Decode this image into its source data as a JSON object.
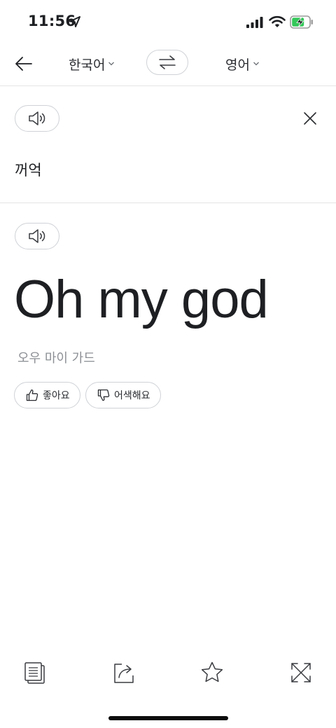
{
  "status_bar": {
    "time": "11:56"
  },
  "header": {
    "source_language": "한국어",
    "target_language": "영어"
  },
  "source": {
    "text": "꺼억"
  },
  "result": {
    "text": "Oh my god",
    "pronunciation": "오우 마이 가드",
    "like_label": "좋아요",
    "dislike_label": "어색해요"
  },
  "colors": {
    "text": "#1d1f22",
    "muted": "#8c8f94",
    "border": "#cfd2d6",
    "battery_green": "#34c759"
  },
  "icons": [
    "location-arrow-icon",
    "cellular-signal-icon",
    "wifi-icon",
    "battery-charging-icon",
    "back-arrow-icon",
    "chevron-down-icon",
    "swap-icon",
    "speaker-icon",
    "close-icon",
    "thumbs-up-icon",
    "thumbs-down-icon",
    "copy-icon",
    "share-icon",
    "star-icon",
    "expand-icon"
  ]
}
